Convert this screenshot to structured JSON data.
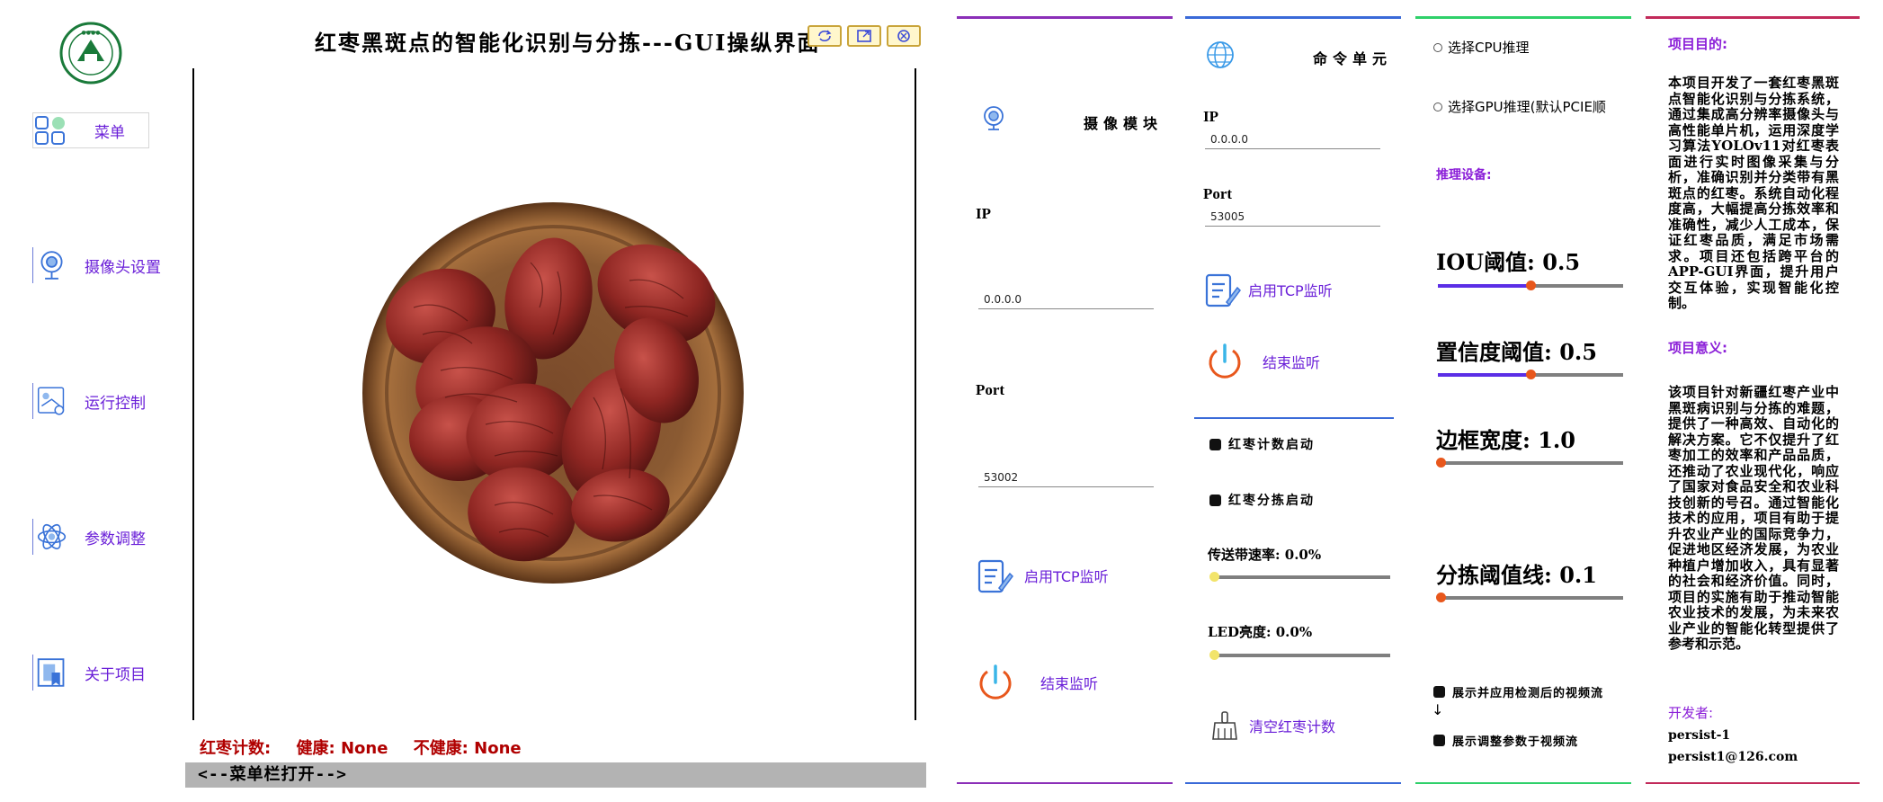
{
  "header": {
    "title": "红枣黑斑点的智能化识别与分拣---GUI操纵界面"
  },
  "sidebar": {
    "menu_label": "菜单",
    "items": [
      {
        "label": "摄像头设置",
        "icon": "camera-icon"
      },
      {
        "label": "运行控制",
        "icon": "run-control-icon"
      },
      {
        "label": "参数调整",
        "icon": "atom-settings-icon"
      },
      {
        "label": "关于项目",
        "icon": "book-icon"
      }
    ]
  },
  "status": {
    "count_label": "红枣计数:",
    "healthy": "健康: None",
    "unhealthy": "不健康: None"
  },
  "menu_toggle": "<--菜单栏打开-->",
  "camera_panel": {
    "title": "摄像模块",
    "ip_label": "IP",
    "ip_value": "0.0.0.0",
    "port_label": "Port",
    "port_value": "53002",
    "tcp_label": "启用TCP监听",
    "stop_label": "结束监听"
  },
  "command_panel": {
    "title": "命令单元",
    "ip_label": "IP",
    "ip_value": "0.0.0.0",
    "port_label": "Port",
    "port_value": "53005",
    "tcp_label": "启用TCP监听",
    "stop_label": "结束监听",
    "count_start": "红枣计数启动",
    "sort_start": "红枣分拣启动",
    "conveyor_label": "传送带速率: 0.0%",
    "conveyor_value": 0.0,
    "led_label": "LED亮度: 0.0%",
    "led_value": 0.0,
    "clear_label": "清空红枣计数"
  },
  "params_panel": {
    "cpu_option": "选择CPU推理",
    "gpu_option": "选择GPU推理(默认PCIE顺",
    "device_label": "推理设备:",
    "iou_label": "IOU阈值: 0.5",
    "iou_value": 0.5,
    "conf_label": "置信度阈值: 0.5",
    "conf_value": 0.5,
    "box_label": "边框宽度: 1.0",
    "box_value": 0.0,
    "sort_label": "分拣阈值线: 0.1",
    "sort_value": 0.0,
    "show_detected": "展示并应用检测后的视频流",
    "arrow": "↓",
    "show_adjusted": "展示调整参数于视频流"
  },
  "about_panel": {
    "purpose_title": "项目目的:",
    "purpose_text": "本项目开发了一套红枣黑斑点智能化识别与分拣系统，通过集成高分辨率摄像头与高性能单片机，运用深度学习算法YOLOv11对红枣表面进行实时图像采集与分析，准确识别并分类带有黑斑点的红枣。系统自动化程度高，大幅提高分拣效率和准确性，减少人工成本，保证红枣品质，满足市场需求。项目还包括跨平台的APP-GUI界面，提升用户交互体验，实现智能化控制。",
    "meaning_title": "项目意义:",
    "meaning_text": "该项目针对新疆红枣产业中黑斑病识别与分拣的难题，提供了一种高效、自动化的解决方案。它不仅提升了红枣加工的效率和产品品质，还推动了农业现代化，响应了国家对食品安全和农业科技创新的号召。通过智能化技术的应用，项目有助于提升农业产业的国际竞争力，促进地区经济发展，为农业种植户增加收入，具有显著的社会和经济价值。同时，项目的实施有助于推动智能农业技术的发展，为未来农业产业的智能化转型提供了参考和示范。",
    "dev_title": "开发者:",
    "dev_name": "persist-1",
    "dev_email": "persist1@126.com"
  },
  "colors": {
    "accent_purple": "#6a1fd8",
    "status_red": "#b00000",
    "slider_fill": "#5b2ee6",
    "knob_orange": "#e8571c",
    "knob_yellow": "#f2e46a"
  }
}
